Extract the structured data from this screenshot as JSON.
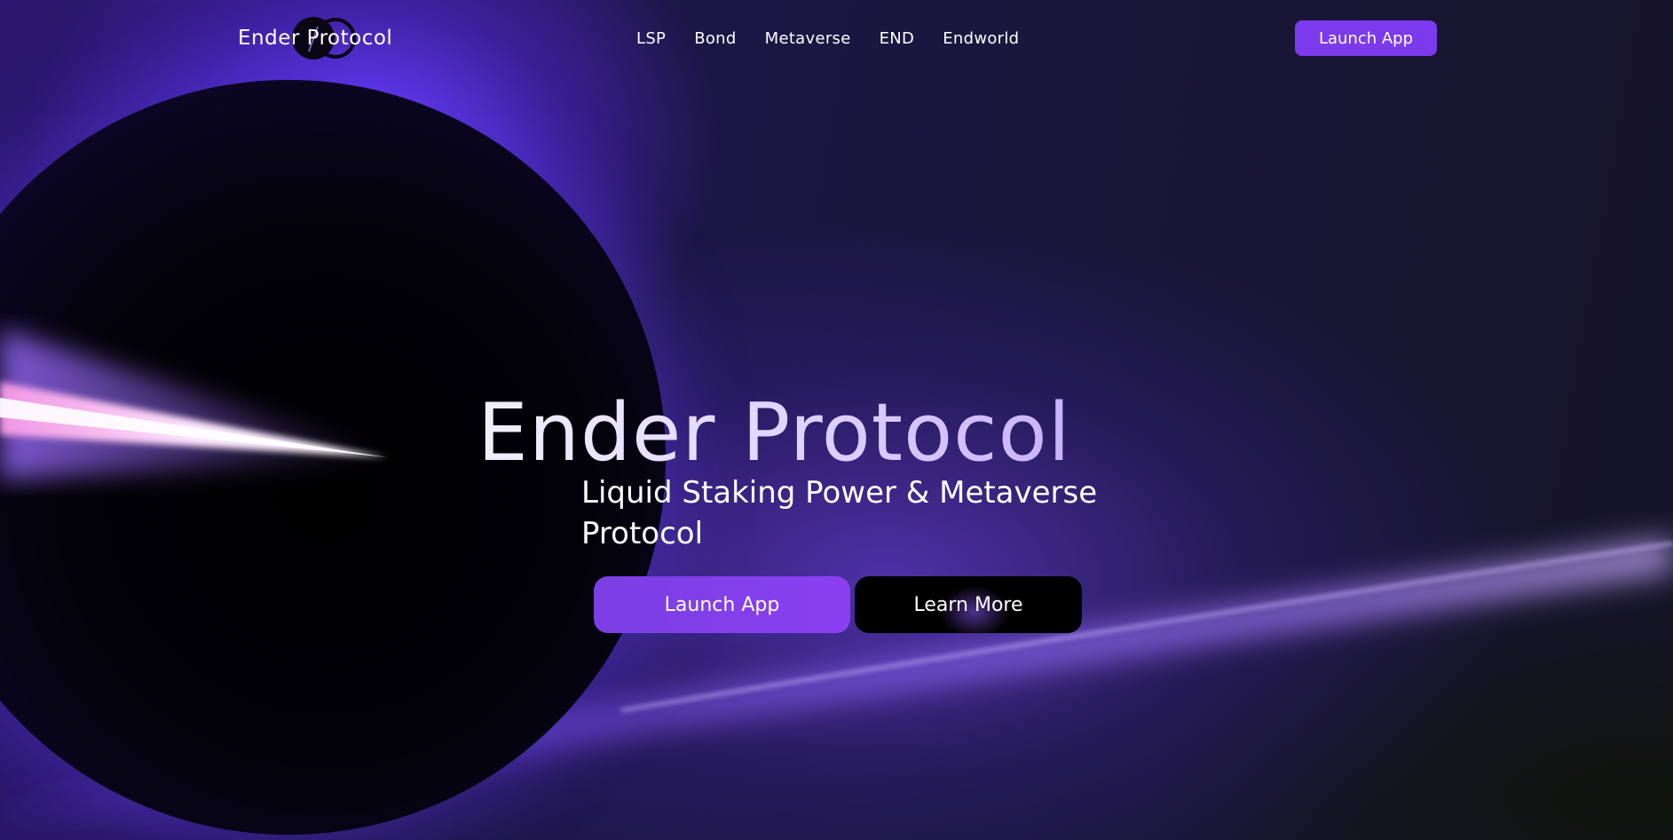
{
  "brand": {
    "name": "Ender Protocol"
  },
  "nav": {
    "links": [
      {
        "label": "LSP"
      },
      {
        "label": "Bond"
      },
      {
        "label": "Metaverse"
      },
      {
        "label": "END"
      },
      {
        "label": "Endworld"
      }
    ],
    "cta_label": "Launch App"
  },
  "hero": {
    "title": "Ender Protocol",
    "subtitle": "Liquid Staking Power & Metaverse Protocol",
    "primary_button": "Launch App",
    "secondary_button": "Learn More"
  },
  "colors": {
    "accent": "#7c3aed",
    "background": "#15122a",
    "text": "#ffffff"
  }
}
